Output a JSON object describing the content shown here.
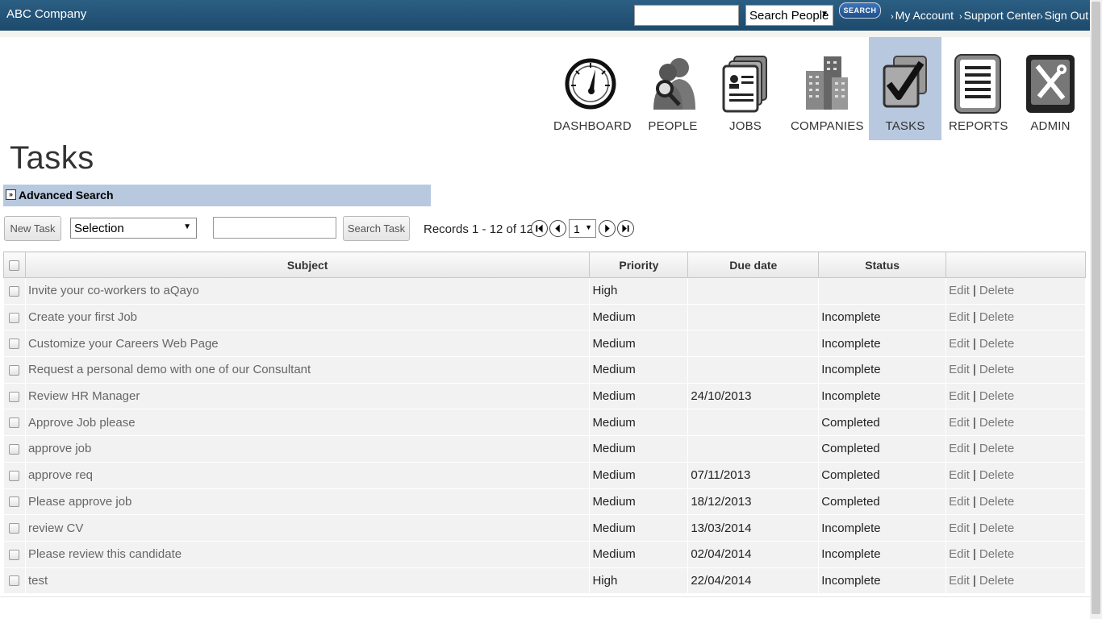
{
  "header": {
    "brand": "ABC Company",
    "search_select_value": "Search People",
    "search_button": "SEARCH",
    "links": [
      "My Account",
      "Support Center",
      "Sign Out"
    ]
  },
  "nav": {
    "items": [
      {
        "label": "DASHBOARD",
        "icon": "dashboard-gauge-icon"
      },
      {
        "label": "PEOPLE",
        "icon": "people-search-icon"
      },
      {
        "label": "JOBS",
        "icon": "jobs-documents-icon"
      },
      {
        "label": "COMPANIES",
        "icon": "companies-buildings-icon"
      },
      {
        "label": "TASKS",
        "icon": "tasks-checkmark-icon",
        "active": true
      },
      {
        "label": "REPORTS",
        "icon": "reports-document-icon"
      },
      {
        "label": "ADMIN",
        "icon": "admin-tools-icon"
      }
    ],
    "active_color": "#b8c8df"
  },
  "page": {
    "title": "Tasks",
    "advanced_search": "Advanced Search"
  },
  "toolbar": {
    "new_task": "New Task",
    "selection_value": "Selection",
    "search_input_value": "",
    "search_task": "Search Task",
    "records": "Records 1 - 12 of 12",
    "page_value": "1"
  },
  "table": {
    "columns": [
      "Subject",
      "Priority",
      "Due date",
      "Status"
    ],
    "edit_label": "Edit",
    "delete_label": "Delete",
    "rows": [
      {
        "subject": "Invite your co-workers to aQayo",
        "priority": "High",
        "due": "",
        "status": ""
      },
      {
        "subject": "Create your first Job",
        "priority": "Medium",
        "due": "",
        "status": "Incomplete"
      },
      {
        "subject": "Customize your Careers Web Page",
        "priority": "Medium",
        "due": "",
        "status": "Incomplete"
      },
      {
        "subject": "Request a personal demo with one of our Consultant",
        "priority": "Medium",
        "due": "",
        "status": "Incomplete"
      },
      {
        "subject": "Review HR Manager",
        "priority": "Medium",
        "due": "24/10/2013",
        "status": "Incomplete"
      },
      {
        "subject": "Approve Job please",
        "priority": "Medium",
        "due": "",
        "status": "Completed"
      },
      {
        "subject": "approve job",
        "priority": "Medium",
        "due": "",
        "status": "Completed"
      },
      {
        "subject": "approve req",
        "priority": "Medium",
        "due": "07/11/2013",
        "status": "Completed"
      },
      {
        "subject": "Please approve job",
        "priority": "Medium",
        "due": "18/12/2013",
        "status": "Completed"
      },
      {
        "subject": "review CV",
        "priority": "Medium",
        "due": "13/03/2014",
        "status": "Incomplete"
      },
      {
        "subject": "Please review this candidate",
        "priority": "Medium",
        "due": "02/04/2014",
        "status": "Incomplete"
      },
      {
        "subject": "test",
        "priority": "High",
        "due": "22/04/2014",
        "status": "Incomplete"
      }
    ]
  }
}
